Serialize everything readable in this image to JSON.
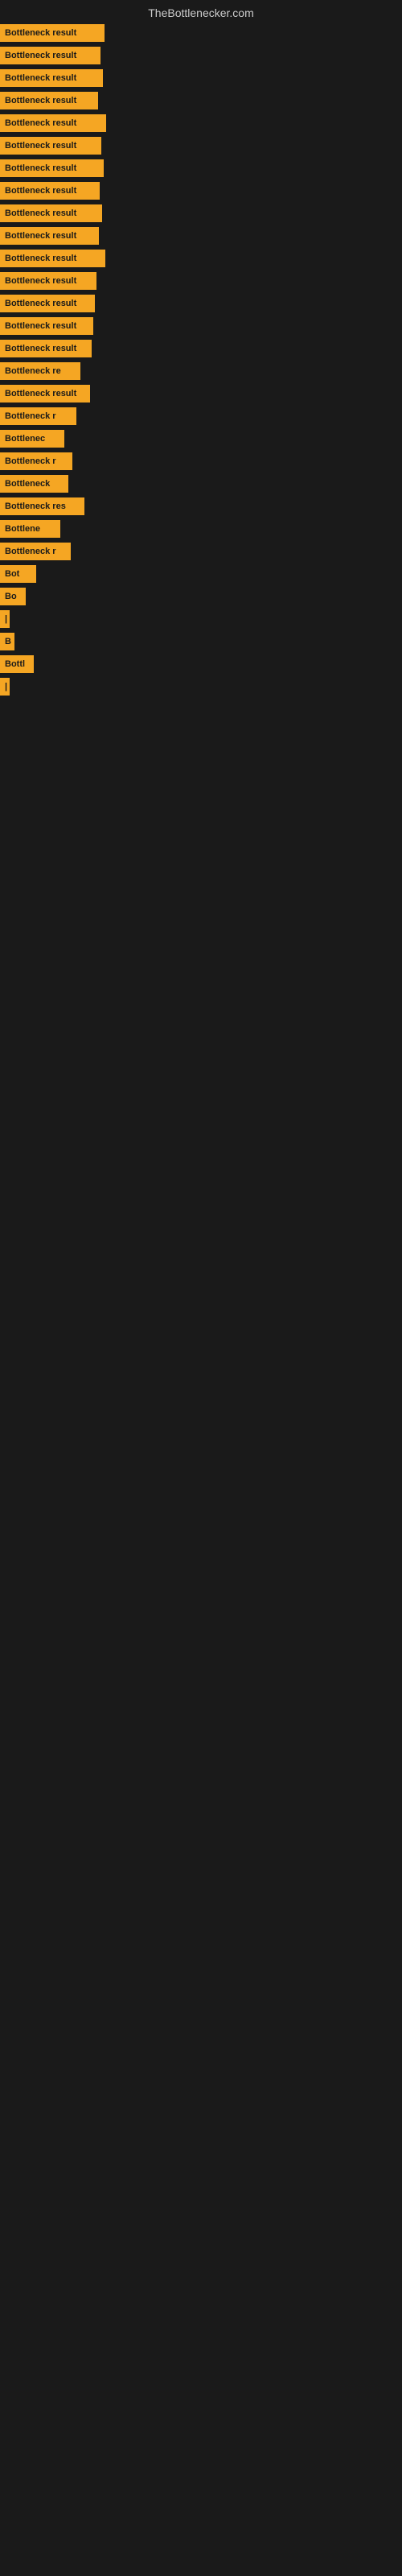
{
  "site": {
    "title": "TheBottlenecker.com"
  },
  "bars": [
    {
      "label": "Bottleneck result",
      "width": 130
    },
    {
      "label": "Bottleneck result",
      "width": 125
    },
    {
      "label": "Bottleneck result",
      "width": 128
    },
    {
      "label": "Bottleneck result",
      "width": 122
    },
    {
      "label": "Bottleneck result",
      "width": 132
    },
    {
      "label": "Bottleneck result",
      "width": 126
    },
    {
      "label": "Bottleneck result",
      "width": 129
    },
    {
      "label": "Bottleneck result",
      "width": 124
    },
    {
      "label": "Bottleneck result",
      "width": 127
    },
    {
      "label": "Bottleneck result",
      "width": 123
    },
    {
      "label": "Bottleneck result",
      "width": 131
    },
    {
      "label": "Bottleneck result",
      "width": 120
    },
    {
      "label": "Bottleneck result",
      "width": 118
    },
    {
      "label": "Bottleneck result",
      "width": 116
    },
    {
      "label": "Bottleneck result",
      "width": 114
    },
    {
      "label": "Bottleneck re",
      "width": 100
    },
    {
      "label": "Bottleneck result",
      "width": 112
    },
    {
      "label": "Bottleneck r",
      "width": 95
    },
    {
      "label": "Bottlenec",
      "width": 80
    },
    {
      "label": "Bottleneck r",
      "width": 90
    },
    {
      "label": "Bottleneck",
      "width": 85
    },
    {
      "label": "Bottleneck res",
      "width": 105
    },
    {
      "label": "Bottlene",
      "width": 75
    },
    {
      "label": "Bottleneck r",
      "width": 88
    },
    {
      "label": "Bot",
      "width": 45
    },
    {
      "label": "Bo",
      "width": 32
    },
    {
      "label": "|",
      "width": 8
    },
    {
      "label": "B",
      "width": 18
    },
    {
      "label": "Bottl",
      "width": 42
    },
    {
      "label": "|",
      "width": 6
    }
  ]
}
